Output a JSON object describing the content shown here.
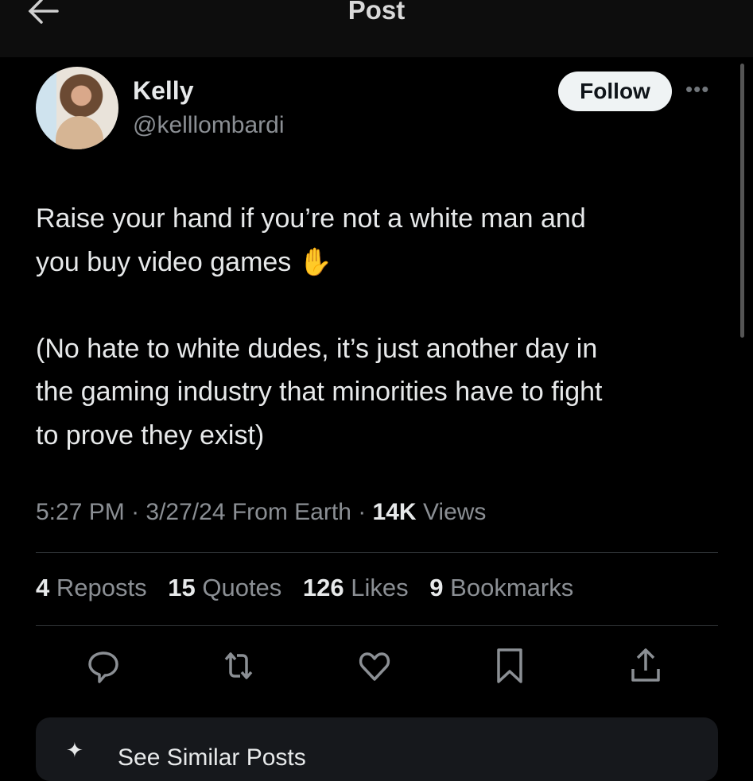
{
  "header": {
    "title": "Post",
    "back_icon": "arrow-left-icon"
  },
  "author": {
    "name": "Kelly",
    "handle": "@kelllombardi",
    "follow_label": "Follow",
    "more_label": "•••"
  },
  "tweet": {
    "text": "Raise your hand if you’re not a white man and\nyou buy video games ✋\n\n(No hate to white dudes, it’s just another day in\nthe gaming industry that minorities have to fight\nto prove they exist)"
  },
  "meta": {
    "time": "5:27 PM",
    "date": "3/27/24",
    "location": "From Earth",
    "views_count": "14K",
    "views_label": "Views"
  },
  "stats": [
    {
      "count": "4",
      "label": "Reposts"
    },
    {
      "count": "15",
      "label": "Quotes"
    },
    {
      "count": "126",
      "label": "Likes"
    },
    {
      "count": "9",
      "label": "Bookmarks"
    }
  ],
  "card": {
    "label": "See Similar Posts"
  }
}
